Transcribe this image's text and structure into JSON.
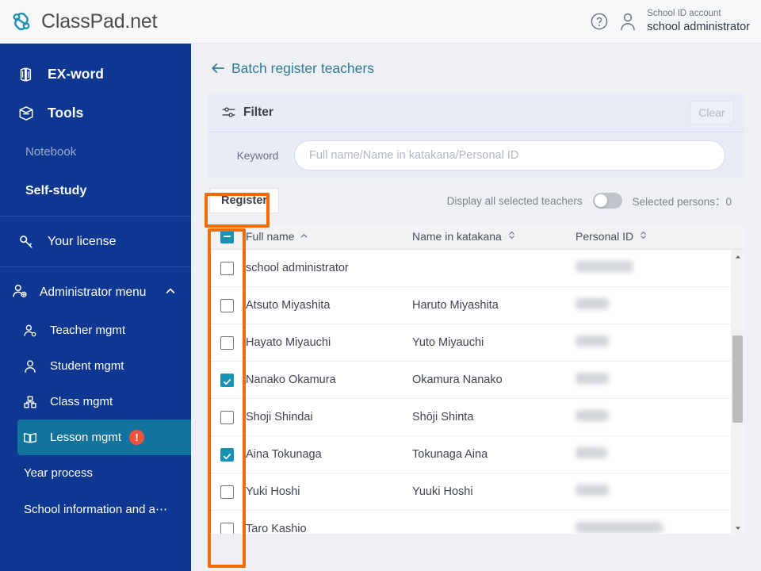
{
  "topbar": {
    "brand": "ClassPad.net",
    "logo_icon": "chain-link-icon",
    "help_icon": "question-mark-circle-icon",
    "user_icon": "user-avatar-icon",
    "account_type": "School ID account",
    "account_name": "school administrator",
    "brand_color": "#1792b5"
  },
  "sidebar": {
    "bg_color": "#0e3792",
    "active_color": "#12739c",
    "top_items": [
      {
        "label": "EX-word",
        "icon": "dictionary-book-icon",
        "style": "bold"
      },
      {
        "label": "Tools",
        "icon": "toolbox-icon",
        "style": "bold"
      },
      {
        "label": "Notebook",
        "icon": "",
        "style": "muted"
      },
      {
        "label": "Self-study",
        "icon": "",
        "style": "bold"
      }
    ],
    "license": {
      "label": "Your license",
      "icon": "key-icon"
    },
    "admin": {
      "label": "Administrator menu",
      "icon": "admin-user-icon",
      "chevron": "chevron-up-icon",
      "expanded": true
    },
    "admin_items": [
      {
        "label": "Teacher mgmt",
        "icon": "teacher-icon",
        "active": false,
        "badge": ""
      },
      {
        "label": "Student mgmt",
        "icon": "student-icon",
        "active": false,
        "badge": ""
      },
      {
        "label": "Class mgmt",
        "icon": "class-icon",
        "active": false,
        "badge": ""
      },
      {
        "label": "Lesson mgmt",
        "icon": "open-book-icon",
        "active": true,
        "badge": "!"
      }
    ],
    "flat_items": [
      {
        "label": "Year process"
      },
      {
        "label": "School information and a⋯"
      }
    ]
  },
  "main": {
    "back_icon": "arrow-left-icon",
    "page_title": "Batch register teachers",
    "filter": {
      "icon": "filter-sliders-icon",
      "title": "Filter",
      "clear_label": "Clear",
      "keyword_label": "Keyword",
      "keyword_value": "",
      "keyword_placeholder": "Full name/Name in katakana/Personal ID"
    },
    "toolbar": {
      "register_label": "Register",
      "display_all_label": "Display all selected teachers",
      "toggle_state": "off",
      "selected_label": "Selected persons：0"
    },
    "table": {
      "select_all_state": "indeterminate",
      "columns": [
        {
          "label": "Full name",
          "sort": "asc"
        },
        {
          "label": "Name in katakana",
          "sort": "none"
        },
        {
          "label": "Personal ID",
          "sort": "none"
        }
      ],
      "rows": [
        {
          "checked": false,
          "full_name": "school administrator",
          "katakana": "",
          "personal_id_redacted": true,
          "pid_width": 72
        },
        {
          "checked": false,
          "full_name": "Atsuto Miyashita",
          "katakana": "Haruto Miyashita",
          "personal_id_redacted": true,
          "pid_width": 42
        },
        {
          "checked": false,
          "full_name": "Hayato Miyauchi",
          "katakana": "Yuto Miyauchi",
          "personal_id_redacted": true,
          "pid_width": 42
        },
        {
          "checked": true,
          "full_name": "Nanako Okamura",
          "katakana": "Okamura Nanako",
          "personal_id_redacted": true,
          "pid_width": 42
        },
        {
          "checked": false,
          "full_name": "Shoji Shindai",
          "katakana": "Shōji Shinta",
          "personal_id_redacted": true,
          "pid_width": 42
        },
        {
          "checked": true,
          "full_name": "Aina Tokunaga",
          "katakana": "Tokunaga Aina",
          "personal_id_redacted": true,
          "pid_width": 40
        },
        {
          "checked": false,
          "full_name": "Yuki Hoshi",
          "katakana": "Yuuki Hoshi",
          "personal_id_redacted": true,
          "pid_width": 42
        },
        {
          "checked": false,
          "full_name": "Taro Kashio",
          "katakana": "",
          "personal_id_redacted": true,
          "pid_width": 110
        }
      ],
      "scrollbar": {
        "up_icon": "scroll-up-arrow-icon",
        "down_icon": "scroll-down-arrow-icon"
      }
    }
  },
  "annotations": {
    "color": "#ef6c0b",
    "boxes": [
      {
        "name": "register-button-highlight"
      },
      {
        "name": "checkbox-column-highlight"
      }
    ]
  }
}
